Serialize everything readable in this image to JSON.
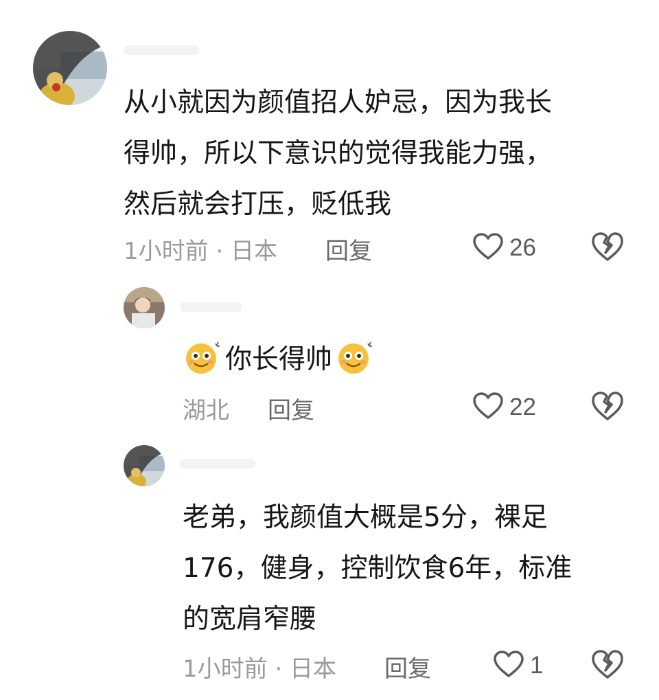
{
  "comments": [
    {
      "text": "从小就因为颜值招人妒忌，因为我长得帅，所以下意识的觉得我能力强，然后就会打压，贬低我",
      "lines": [
        "从小就因为颜值招人妒忌，因为我长",
        "得帅，所以下意识的觉得我能力强，",
        "然后就会打压，贬低我"
      ],
      "meta": "1小时前 · 日本",
      "reply_label": "回复",
      "likes": "26",
      "avatar_icon": "car-window-avatar"
    },
    {
      "text": "你长得帅",
      "meta": "湖北",
      "reply_label": "回复",
      "likes": "22",
      "emoji_icon": "dizzy-smile-emoji",
      "avatar_icon": "person-avatar"
    },
    {
      "text": "老弟，我颜值大概是5分，裸足176，健身，控制饮食6年，标准的宽肩窄腰",
      "lines": [
        "老弟，我颜值大概是5分，裸足",
        "176，健身，控制饮食6年，标准",
        "的宽肩窄腰"
      ],
      "meta": "1小时前 · 日本",
      "reply_label": "回复",
      "likes": "1",
      "avatar_icon": "car-window-avatar"
    }
  ],
  "colors": {
    "text": "#161616",
    "meta": "#9a9a9a",
    "reply": "#6a6a6a",
    "icon": "#5a5a5a",
    "emoji_face": "#f7c23b"
  }
}
